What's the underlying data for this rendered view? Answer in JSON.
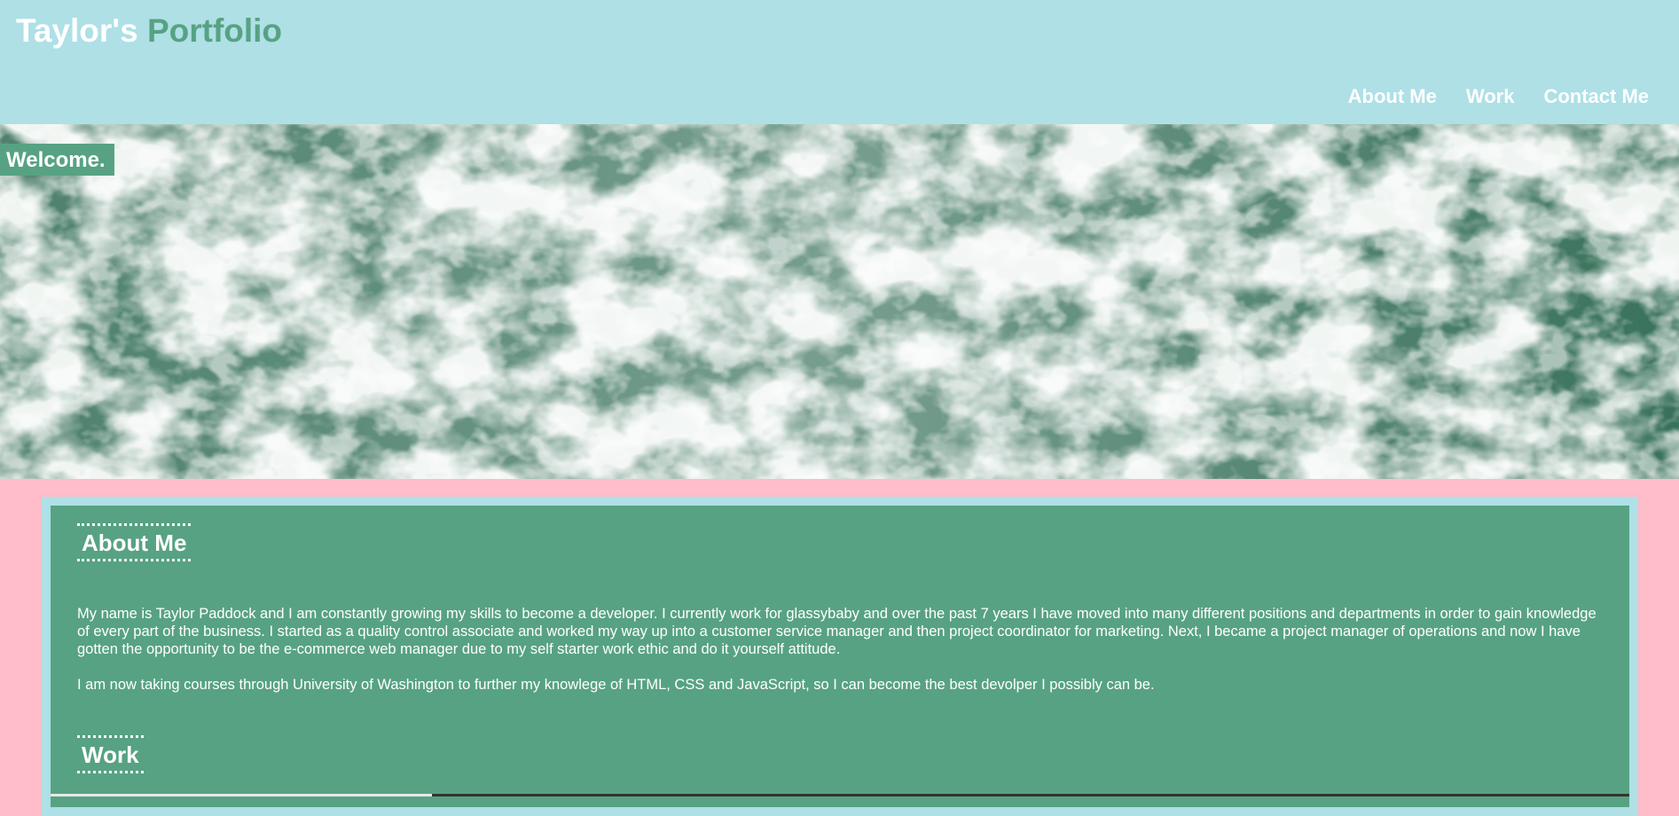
{
  "header": {
    "title_main": "Taylor's",
    "title_accent": "Portfolio",
    "nav": [
      {
        "label": "About Me"
      },
      {
        "label": "Work"
      },
      {
        "label": "Contact Me"
      }
    ]
  },
  "hero": {
    "welcome": "Welcome."
  },
  "about": {
    "heading": "About Me",
    "paragraphs": [
      "My name is Taylor Paddock and I am constantly growing my skills to become a developer. I currently work for glassybaby and over the past 7 years I have moved into many different positions and departments in order to gain knowledge of every part of the business. I started as a quality control associate and worked my way up into a customer service manager and then project coordinator for marketing. Next, I became a project manager of operations and now I have gotten the opportunity to be the e-commerce web manager due to my self starter work ethic and do it yourself attitude.",
      "I am now taking courses through University of Washington to further my knowlege of HTML, CSS and JavaScript, so I can become the best devolper I possibly can be."
    ]
  },
  "work": {
    "heading": "Work"
  },
  "colors": {
    "header_bg": "#aee0e6",
    "accent_green": "#57a283",
    "page_bg": "#ffbcc9",
    "text_white": "#ffffff"
  }
}
